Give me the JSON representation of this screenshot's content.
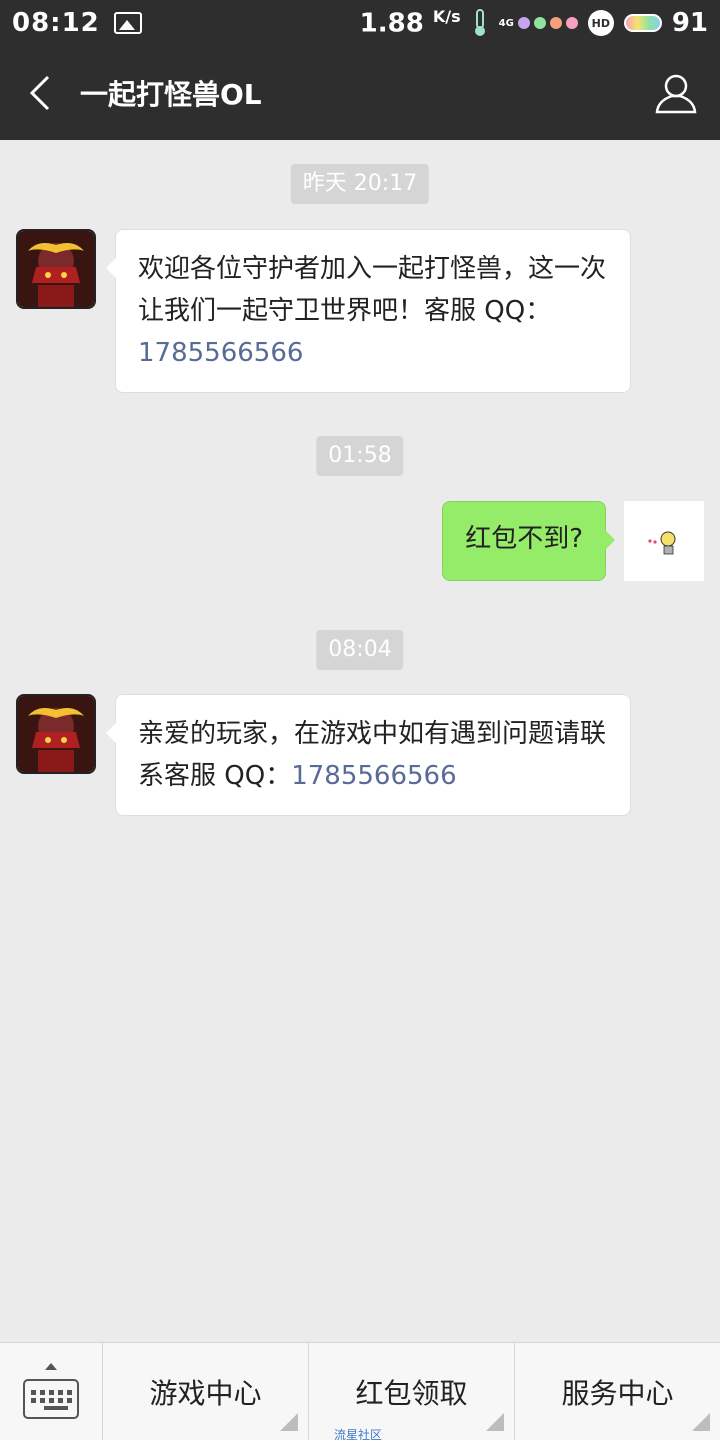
{
  "status_bar": {
    "time": "08:12",
    "speed_value": "1.88",
    "speed_unit": "K/s",
    "network": "4G",
    "hd": "HD",
    "battery_level": "91"
  },
  "title_bar": {
    "title": "一起打怪兽OL"
  },
  "messages": [
    {
      "timestamp": "昨天 20:17",
      "text_main": "欢迎各位守护者加入一起打怪兽，这一次让我们一起守卫世界吧！客服 QQ：",
      "text_link": "1785566566",
      "direction": "in"
    },
    {
      "timestamp": "01:58",
      "text_main": "红包不到?",
      "direction": "out"
    },
    {
      "timestamp": "08:04",
      "text_main": "亲爱的玩家，在游戏中如有遇到问题请联系客服 QQ：",
      "text_link": "1785566566",
      "direction": "in"
    }
  ],
  "bottom_menu": {
    "items": [
      "游戏中心",
      "红包领取",
      "服务中心"
    ]
  },
  "watermark": "流星社区",
  "colors": {
    "header": "#2e2e2e",
    "background": "#ebebeb",
    "outgoing_bubble": "#95ec69",
    "link": "#576b95"
  }
}
